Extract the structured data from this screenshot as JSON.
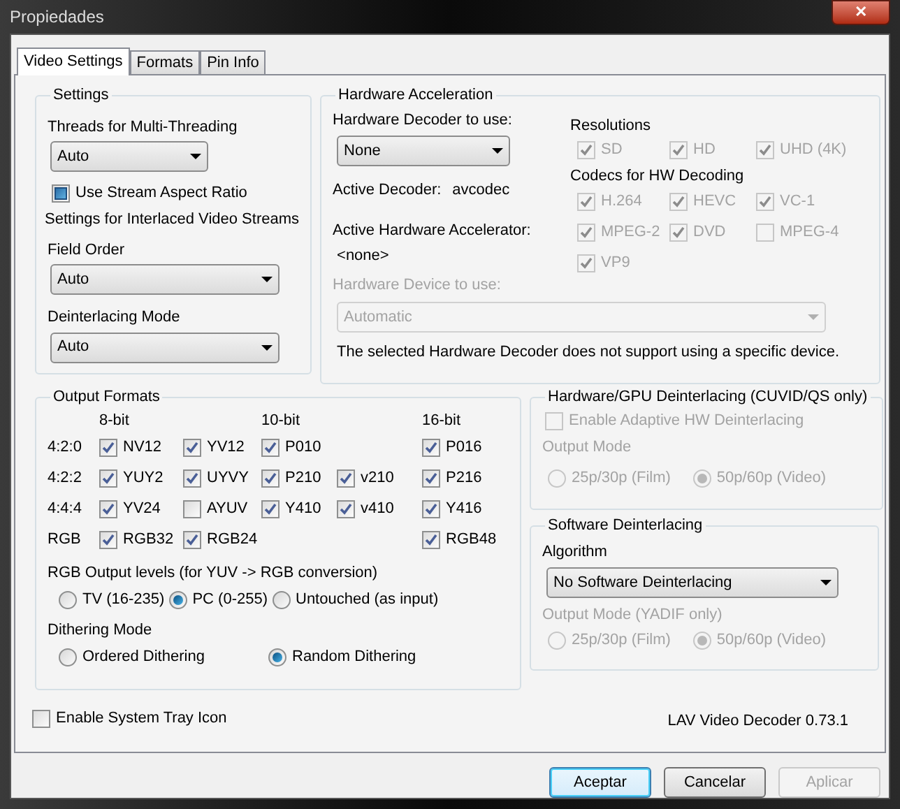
{
  "window": {
    "title": "Propiedades",
    "close": "✕"
  },
  "tabs": [
    {
      "label": "Video Settings",
      "selected": true
    },
    {
      "label": "Formats",
      "selected": false
    },
    {
      "label": "Pin Info",
      "selected": false
    }
  ],
  "settings": {
    "title": "Settings",
    "threads": {
      "label": "Threads for Multi-Threading",
      "value": "Auto"
    },
    "aspect": {
      "label": "Use Stream Aspect Ratio",
      "indeterminate": true
    },
    "interlaced_heading": "Settings for Interlaced Video Streams",
    "field_order": {
      "label": "Field Order",
      "value": "Auto"
    },
    "deint_mode": {
      "label": "Deinterlacing Mode",
      "value": "Auto"
    }
  },
  "hw": {
    "title": "Hardware Acceleration",
    "decoder": {
      "label": "Hardware Decoder to use:",
      "value": "None"
    },
    "active_decoder": {
      "label": "Active Decoder:",
      "value": "avcodec"
    },
    "accelerator": {
      "label": "Active Hardware Accelerator:",
      "value": "<none>"
    },
    "device": {
      "label": "Hardware Device to use:",
      "value": "Automatic",
      "disabled": true
    },
    "note": "The selected Hardware Decoder does not support using a specific device.",
    "resolutions_title": "Resolutions",
    "resolutions": [
      {
        "label": "SD",
        "checked": true,
        "disabled": true
      },
      {
        "label": "HD",
        "checked": true,
        "disabled": true
      },
      {
        "label": "UHD (4K)",
        "checked": true,
        "disabled": true
      }
    ],
    "codecs_title": "Codecs for HW Decoding",
    "codecs": [
      {
        "label": "H.264",
        "checked": true,
        "disabled": true
      },
      {
        "label": "HEVC",
        "checked": true,
        "disabled": true
      },
      {
        "label": "VC-1",
        "checked": true,
        "disabled": true
      },
      {
        "label": "MPEG-2",
        "checked": true,
        "disabled": true
      },
      {
        "label": "DVD",
        "checked": true,
        "disabled": true
      },
      {
        "label": "MPEG-4",
        "checked": false,
        "disabled": true
      },
      {
        "label": "VP9",
        "checked": true,
        "disabled": true
      }
    ]
  },
  "output": {
    "title": "Output Formats",
    "columns": [
      {
        "label": "8-bit"
      },
      {
        "label": "10-bit"
      },
      {
        "label": "16-bit"
      }
    ],
    "rows": [
      {
        "label": "4:2:0",
        "formats": [
          {
            "label": "NV12",
            "checked": true
          },
          {
            "label": "YV12",
            "checked": true
          },
          {
            "label": "P010",
            "checked": true
          },
          {
            "kind": "gap"
          },
          {
            "label": "P016",
            "checked": true
          }
        ]
      },
      {
        "label": "4:2:2",
        "formats": [
          {
            "label": "YUY2",
            "checked": true
          },
          {
            "label": "UYVY",
            "checked": true
          },
          {
            "label": "P210",
            "checked": true
          },
          {
            "label": "v210",
            "checked": true
          },
          {
            "label": "P216",
            "checked": true
          }
        ]
      },
      {
        "label": "4:4:4",
        "formats": [
          {
            "label": "YV24",
            "checked": true
          },
          {
            "label": "AYUV",
            "checked": false
          },
          {
            "label": "Y410",
            "checked": true
          },
          {
            "label": "v410",
            "checked": true
          },
          {
            "label": "Y416",
            "checked": true
          }
        ]
      },
      {
        "label": "RGB",
        "formats": [
          {
            "label": "RGB32",
            "checked": true
          },
          {
            "label": "RGB24",
            "checked": true
          },
          {
            "kind": "gap"
          },
          {
            "kind": "gap"
          },
          {
            "label": "RGB48",
            "checked": true
          }
        ]
      }
    ],
    "levels": {
      "title": "RGB Output levels (for YUV -> RGB conversion)",
      "options": [
        {
          "label": "TV (16-235)",
          "selected": false
        },
        {
          "label": "PC (0-255)",
          "selected": true
        },
        {
          "label": "Untouched (as input)",
          "selected": false
        }
      ]
    },
    "dithering": {
      "title": "Dithering Mode",
      "options": [
        {
          "label": "Ordered Dithering",
          "selected": false
        },
        {
          "label": "Random Dithering",
          "selected": true
        }
      ]
    }
  },
  "hw_deint": {
    "title": "Hardware/GPU Deinterlacing (CUVID/QS only)",
    "disabled": true,
    "enable": {
      "label": "Enable Adaptive HW Deinterlacing",
      "checked": false
    },
    "mode_label": "Output Mode",
    "options": [
      {
        "label": "25p/30p (Film)",
        "selected": false
      },
      {
        "label": "50p/60p (Video)",
        "selected": true
      }
    ]
  },
  "sw_deint": {
    "title": "Software Deinterlacing",
    "algorithm": {
      "label": "Algorithm",
      "value": "No Software Deinterlacing"
    },
    "mode_label": "Output Mode (YADIF only)",
    "mode_disabled": true,
    "options": [
      {
        "label": "25p/30p (Film)",
        "selected": false
      },
      {
        "label": "50p/60p (Video)",
        "selected": true
      }
    ]
  },
  "tray": {
    "label": "Enable System Tray Icon",
    "checked": false
  },
  "version": "LAV Video Decoder 0.73.1",
  "buttons": [
    {
      "label": "Aceptar",
      "default": true,
      "disabled": false
    },
    {
      "label": "Cancelar",
      "default": false,
      "disabled": false
    },
    {
      "label": "Aplicar",
      "default": false,
      "disabled": true
    }
  ]
}
